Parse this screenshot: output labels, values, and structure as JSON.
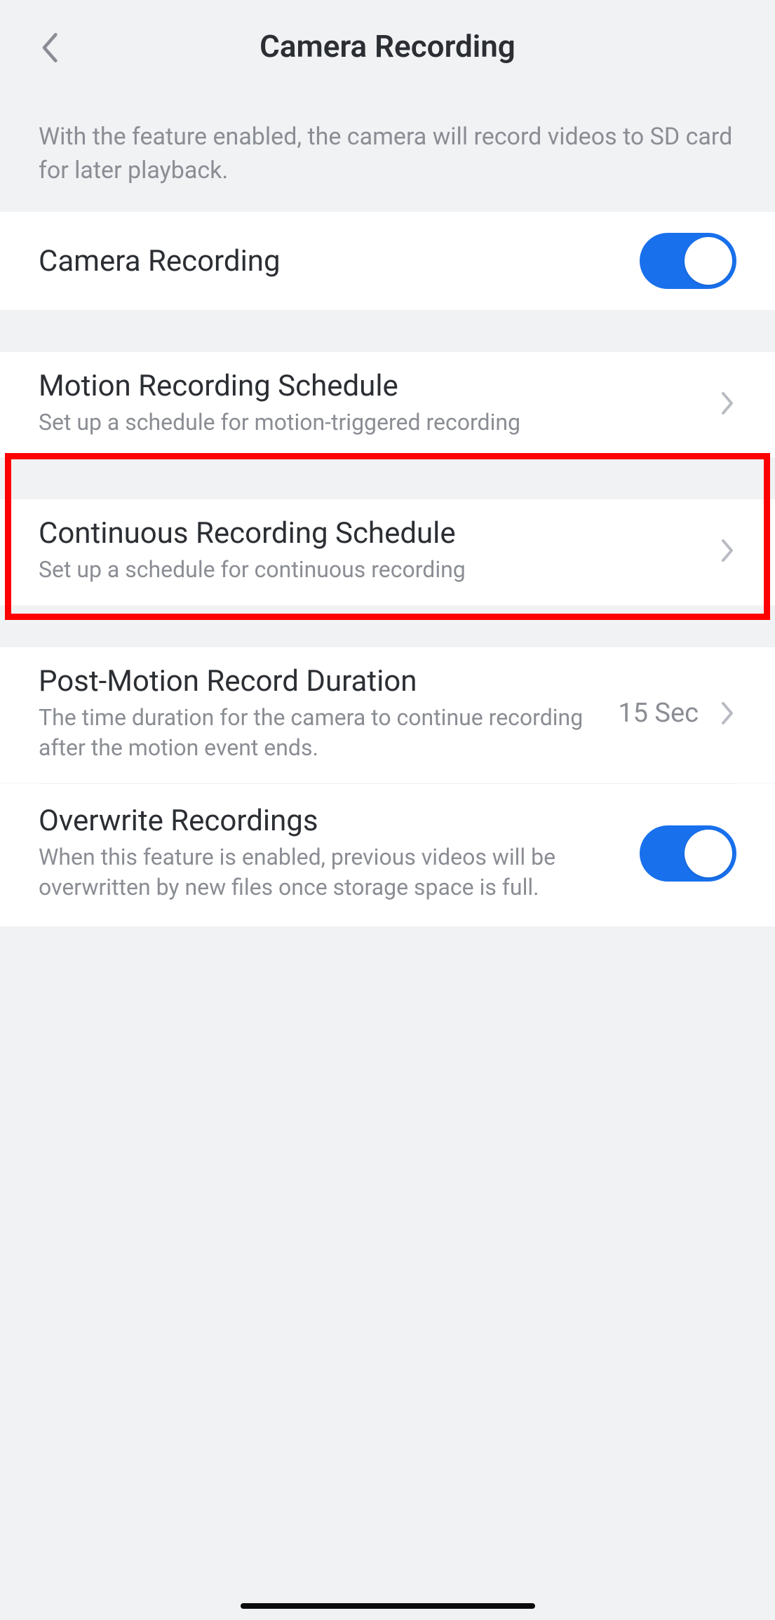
{
  "header": {
    "title": "Camera Recording"
  },
  "intro": {
    "text": "With the feature enabled, the camera will record videos to SD card for later playback."
  },
  "camera_recording": {
    "label": "Camera Recording",
    "enabled": true
  },
  "motion_schedule": {
    "label": "Motion Recording Schedule",
    "sub": "Set up a schedule for motion-triggered recording"
  },
  "continuous_schedule": {
    "label": "Continuous Recording Schedule",
    "sub": "Set up a schedule for continuous recording"
  },
  "post_motion": {
    "label": "Post-Motion Record Duration",
    "sub": "The time duration for the camera to continue recording after the motion event ends.",
    "value": "15 Sec"
  },
  "overwrite": {
    "label": "Overwrite Recordings",
    "sub": "When this feature is enabled, previous videos will be overwritten by new files once storage space is full.",
    "enabled": true
  }
}
